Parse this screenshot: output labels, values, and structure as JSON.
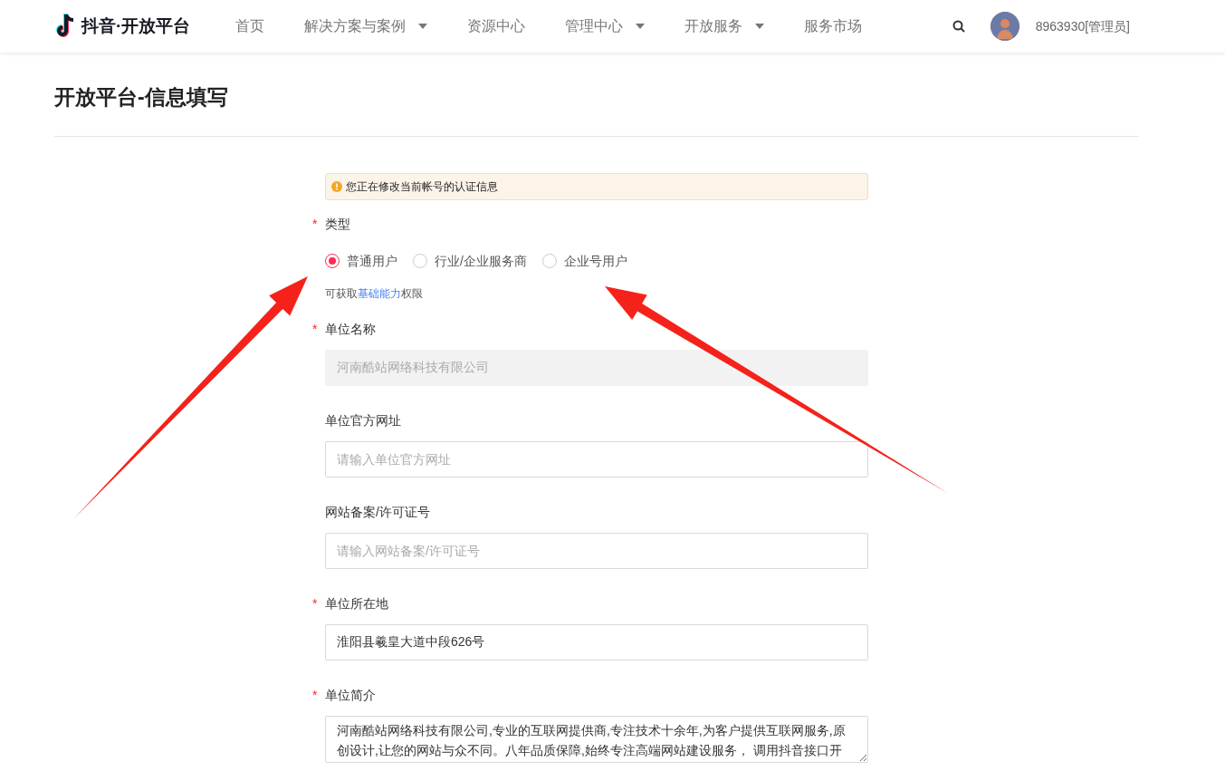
{
  "header": {
    "logo_text": "抖音·开放平台",
    "nav": [
      {
        "label": "首页",
        "has_dropdown": false
      },
      {
        "label": "解决方案与案例",
        "has_dropdown": true
      },
      {
        "label": "资源中心",
        "has_dropdown": false
      },
      {
        "label": "管理中心",
        "has_dropdown": true
      },
      {
        "label": "开放服务",
        "has_dropdown": true
      },
      {
        "label": "服务市场",
        "has_dropdown": false
      }
    ],
    "user": "8963930[管理员]"
  },
  "page_title": "开放平台-信息填写",
  "required_mark": "*",
  "notice": "您正在修改当前帐号的认证信息",
  "type_field": {
    "label": "类型",
    "required": true,
    "options": [
      {
        "label": "普通用户",
        "selected": true
      },
      {
        "label": "行业/企业服务商",
        "selected": false
      },
      {
        "label": "企业号用户",
        "selected": false
      }
    ],
    "hint_prefix": "可获取",
    "hint_link": "基础能力",
    "hint_suffix": "权限"
  },
  "fields": [
    {
      "kind": "input",
      "label": "单位名称",
      "required": true,
      "disabled": true,
      "value": "河南酷站网络科技有限公司"
    },
    {
      "kind": "input",
      "label": "单位官方网址",
      "required": false,
      "disabled": false,
      "placeholder": "请输入单位官方网址"
    },
    {
      "kind": "input",
      "label": "网站备案/许可证号",
      "required": false,
      "disabled": false,
      "placeholder": "请输入网站备案/许可证号"
    },
    {
      "kind": "input",
      "label": "单位所在地",
      "required": true,
      "disabled": false,
      "value": "淮阳县羲皇大道中段626号"
    },
    {
      "kind": "textarea",
      "label": "单位简介",
      "required": true,
      "disabled": false,
      "value": "河南酷站网络科技有限公司,专业的互联网提供商,专注技术十余年,为客户提供互联网服务,原创设计,让您的网站与众不同。八年品质保障,始终专注高端网站建设服务， 调用抖音接口开"
    }
  ]
}
